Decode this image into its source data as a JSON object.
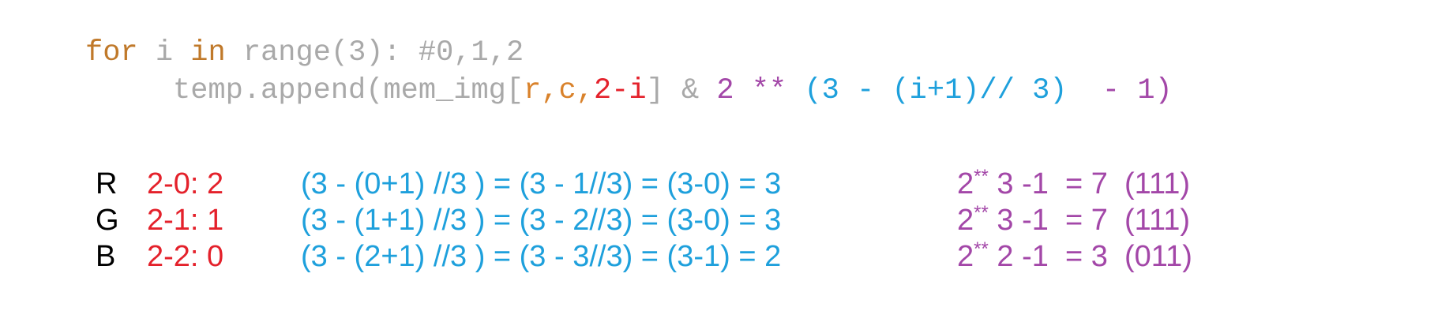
{
  "code": {
    "line1": {
      "kw_for": "for",
      "var_i": " i ",
      "kw_in": "in",
      "call": " range(3): ",
      "comment": "#0,1,2"
    },
    "line2": {
      "t1": "temp.append(mem_img[",
      "t2": "r",
      "t3": ",",
      "t4": "c",
      "t5": ",",
      "t6": "2-",
      "t7": "i",
      "t8": "] & ",
      "t9": "2 **",
      "t10": " (3 - (i+1)// 3) ",
      "t11": " - 1)"
    }
  },
  "rows": [
    {
      "channel": "R",
      "index": "2-0: 2",
      "expr": "(3 - (0+1) //3 ) = (3 - 1//3) = (3-0) = 3",
      "res_a": "2",
      "res_b": "**",
      "res_c": " 3 -1  = 7  (111)"
    },
    {
      "channel": "G",
      "index": "2-1: 1",
      "expr": "(3 - (1+1) //3 ) = (3 - 2//3) = (3-0) = 3",
      "res_a": "2",
      "res_b": "**",
      "res_c": " 3 -1  = 7  (111)"
    },
    {
      "channel": "B",
      "index": "2-2: 0",
      "expr": "(3 - (2+1) //3 ) = (3 - 3//3) = (3-1) = 2",
      "res_a": "2",
      "res_b": "**",
      "res_c": " 2 -1  = 3  (011)"
    }
  ],
  "colors": {
    "keyword": "#c0792a",
    "code_gray": "#a9a9a9",
    "purple": "#a347a8",
    "blue": "#1ea0dc",
    "red": "#e4212b"
  }
}
